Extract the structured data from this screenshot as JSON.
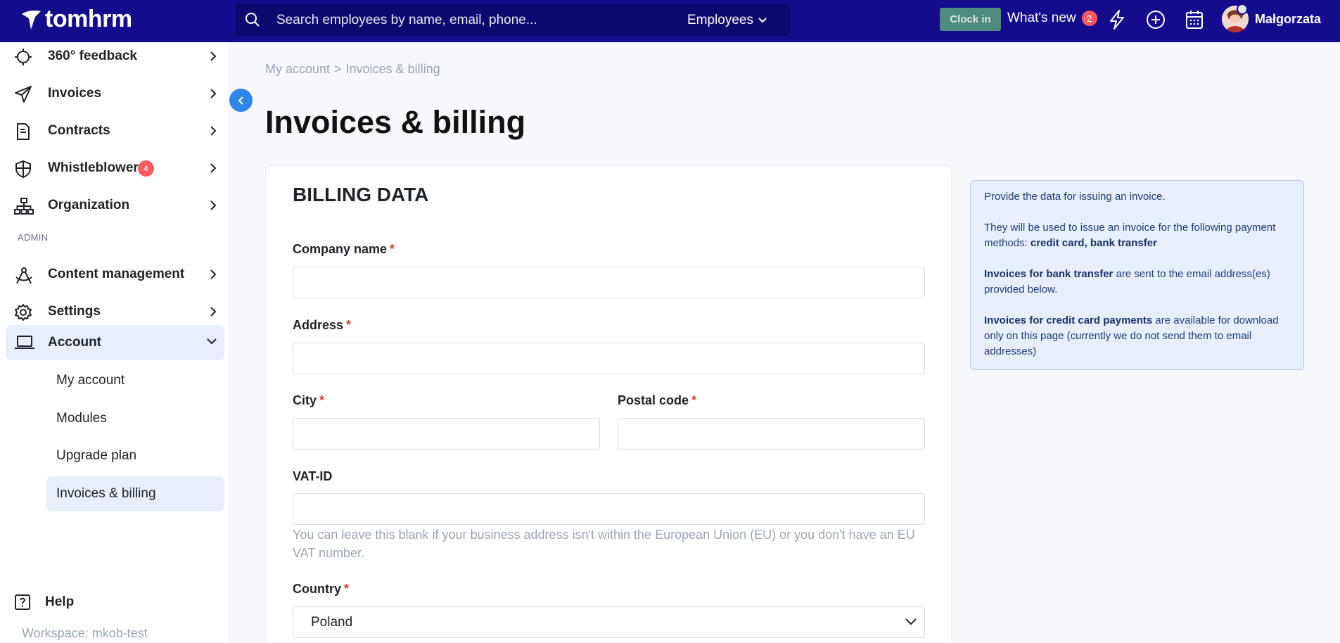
{
  "topbar": {
    "logo_text": "tomhrm",
    "search_placeholder": "Search employees by name, email, phone...",
    "search_scope": "Employees",
    "clock_in": "Clock in",
    "whats_new": "What's new",
    "whats_new_count": "2",
    "user_name": "Małgorzata"
  },
  "sidebar": {
    "items": [
      {
        "label": "360° feedback",
        "icon": "target-icon"
      },
      {
        "label": "Invoices",
        "icon": "paper-plane-icon"
      },
      {
        "label": "Contracts",
        "icon": "document-icon"
      },
      {
        "label": "Whistleblower",
        "icon": "shield-icon",
        "badge": "4"
      },
      {
        "label": "Organization",
        "icon": "org-chart-icon"
      }
    ],
    "admin_label": "ADMIN",
    "admin_items": [
      {
        "label": "Content management",
        "icon": "compass-icon"
      },
      {
        "label": "Settings",
        "icon": "gear-icon"
      },
      {
        "label": "Account",
        "icon": "laptop-icon"
      }
    ],
    "account_sub": [
      "My account",
      "Modules",
      "Upgrade plan",
      "Invoices & billing"
    ],
    "help": "Help",
    "workspace": "Workspace: mkob-test"
  },
  "breadcrumb": {
    "parent": "My account",
    "separator": ">",
    "current": "Invoices & billing"
  },
  "page_title": "Invoices & billing",
  "form": {
    "title": "BILLING DATA",
    "required_mark": "*",
    "company_name_label": "Company name",
    "address_label": "Address",
    "city_label": "City",
    "postal_code_label": "Postal code",
    "vat_label": "VAT-ID",
    "vat_hint": "You can leave this blank if your business address isn't within the European Union (EU) or you don't have an EU VAT number.",
    "country_label": "Country",
    "country_value": "Poland"
  },
  "info": {
    "p1": "Provide the data for issuing an invoice.",
    "p2_text": "They will be used to issue an invoice for the following payment methods: ",
    "p2_bold": "credit card, bank transfer",
    "p3_bold": "Invoices for bank transfer",
    "p3_text": " are sent to the email address(es) provided below.",
    "p4_bold": "Invoices for credit card payments",
    "p4_text": " are available for download only on this page (currently we do not send them to email addresses)"
  }
}
